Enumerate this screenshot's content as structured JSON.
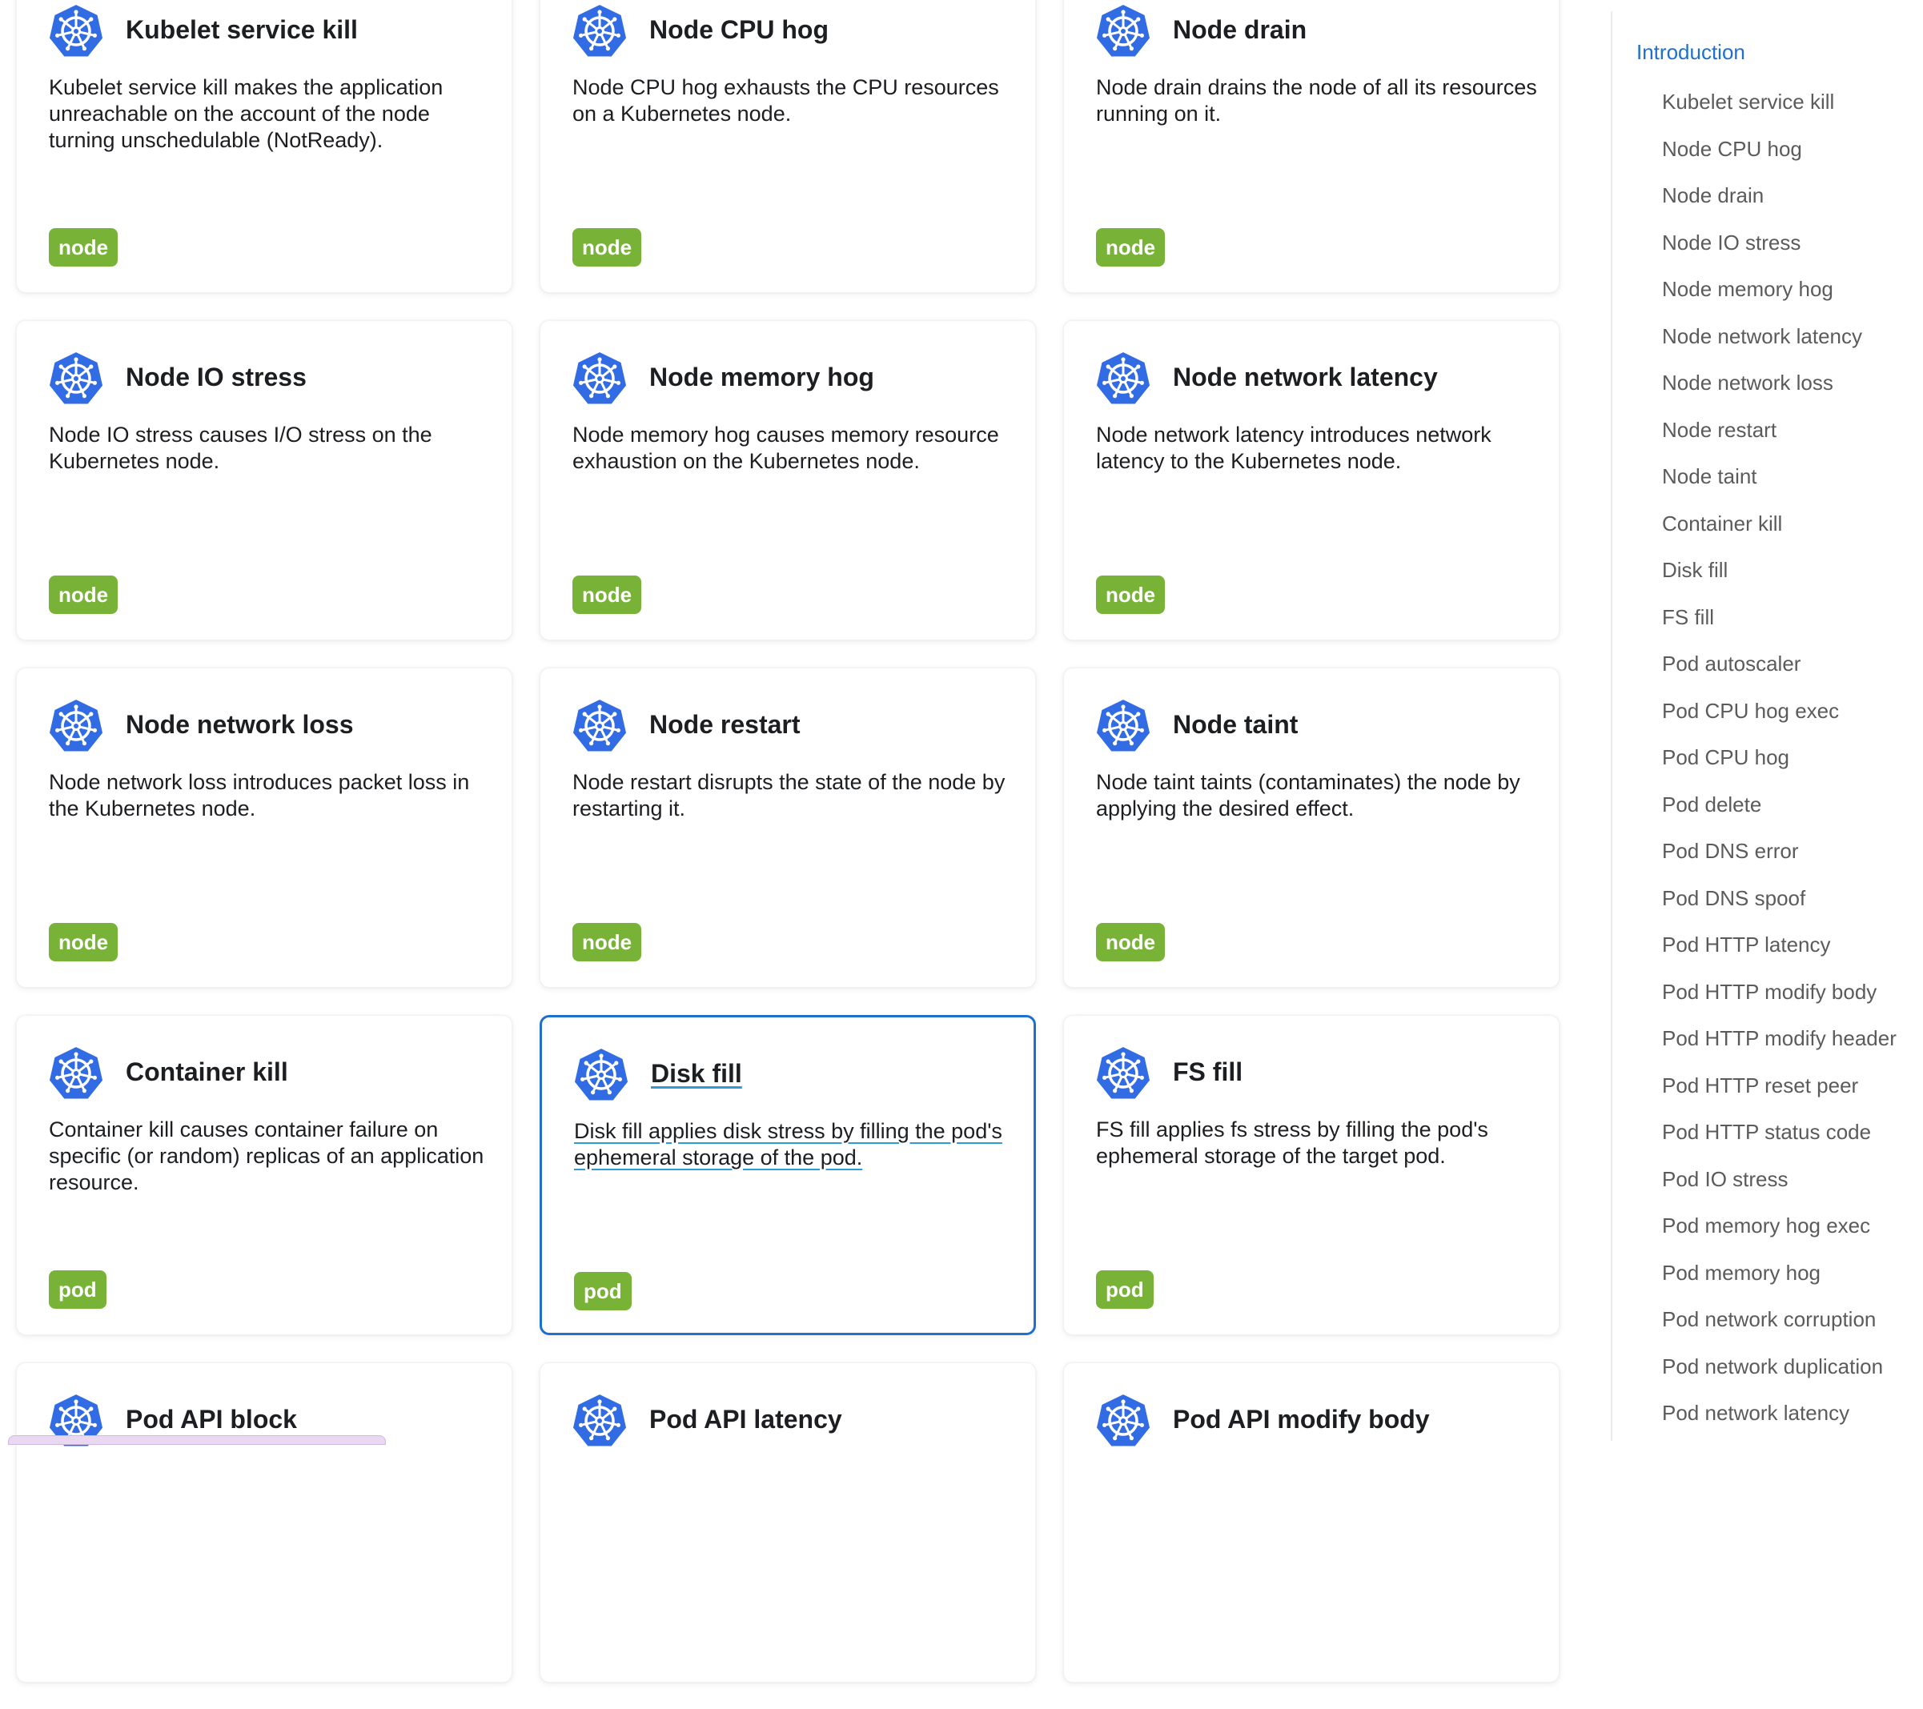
{
  "cards": [
    {
      "title": "Kubelet service kill",
      "description": "Kubelet service kill makes the application unreachable on the account of the node turning unschedulable (NotReady).",
      "tag": "node",
      "icon": "kubernetes-helm-icon"
    },
    {
      "title": "Node CPU hog",
      "description": "Node CPU hog exhausts the CPU resources on a Kubernetes node.",
      "tag": "node",
      "icon": "kubernetes-helm-icon"
    },
    {
      "title": "Node drain",
      "description": "Node drain drains the node of all its resources running on it.",
      "tag": "node",
      "icon": "kubernetes-helm-icon"
    },
    {
      "title": "Node IO stress",
      "description": "Node IO stress causes I/O stress on the Kubernetes node.",
      "tag": "node",
      "icon": "kubernetes-helm-icon"
    },
    {
      "title": "Node memory hog",
      "description": "Node memory hog causes memory resource exhaustion on the Kubernetes node.",
      "tag": "node",
      "icon": "kubernetes-helm-icon"
    },
    {
      "title": "Node network latency",
      "description": "Node network latency introduces network latency to the Kubernetes node.",
      "tag": "node",
      "icon": "kubernetes-helm-icon"
    },
    {
      "title": "Node network loss",
      "description": "Node network loss introduces packet loss in the Kubernetes node.",
      "tag": "node",
      "icon": "kubernetes-helm-icon"
    },
    {
      "title": "Node restart",
      "description": "Node restart disrupts the state of the node by restarting it.",
      "tag": "node",
      "icon": "kubernetes-helm-icon"
    },
    {
      "title": "Node taint",
      "description": "Node taint taints (contaminates) the node by applying the desired effect.",
      "tag": "node",
      "icon": "kubernetes-helm-icon"
    },
    {
      "title": "Container kill",
      "description": "Container kill causes container failure on specific (or random) replicas of an application resource.",
      "tag": "pod",
      "icon": "kubernetes-helm-icon"
    },
    {
      "title": "Disk fill",
      "description": "Disk fill applies disk stress by filling the pod's ephemeral storage of the pod.",
      "tag": "pod",
      "icon": "kubernetes-helm-icon",
      "active": true
    },
    {
      "title": "FS fill",
      "description": "FS fill applies fs stress by filling the pod's ephemeral storage of the target pod.",
      "tag": "pod",
      "icon": "kubernetes-helm-icon"
    },
    {
      "title": "Pod API block",
      "description": "",
      "tag": "",
      "icon": "kubernetes-helm-icon"
    },
    {
      "title": "Pod API latency",
      "description": "",
      "tag": "",
      "icon": "kubernetes-helm-icon"
    },
    {
      "title": "Pod API modify body",
      "description": "",
      "tag": "",
      "icon": "kubernetes-helm-icon"
    }
  ],
  "toc": {
    "intro": "Introduction",
    "items": [
      "Kubelet service kill",
      "Node CPU hog",
      "Node drain",
      "Node IO stress",
      "Node memory hog",
      "Node network latency",
      "Node network loss",
      "Node restart",
      "Node taint",
      "Container kill",
      "Disk fill",
      "FS fill",
      "Pod autoscaler",
      "Pod CPU hog exec",
      "Pod CPU hog",
      "Pod delete",
      "Pod DNS error",
      "Pod DNS spoof",
      "Pod HTTP latency",
      "Pod HTTP modify body",
      "Pod HTTP modify header",
      "Pod HTTP reset peer",
      "Pod HTTP status code",
      "Pod IO stress",
      "Pod memory hog exec",
      "Pod memory hog",
      "Pod network corruption",
      "Pod network duplication",
      "Pod network latency"
    ]
  },
  "colors": {
    "accent": "#1e6fce",
    "tag": "#78b337",
    "icon": "#326ce5",
    "toc_text": "#5b5b5b"
  }
}
